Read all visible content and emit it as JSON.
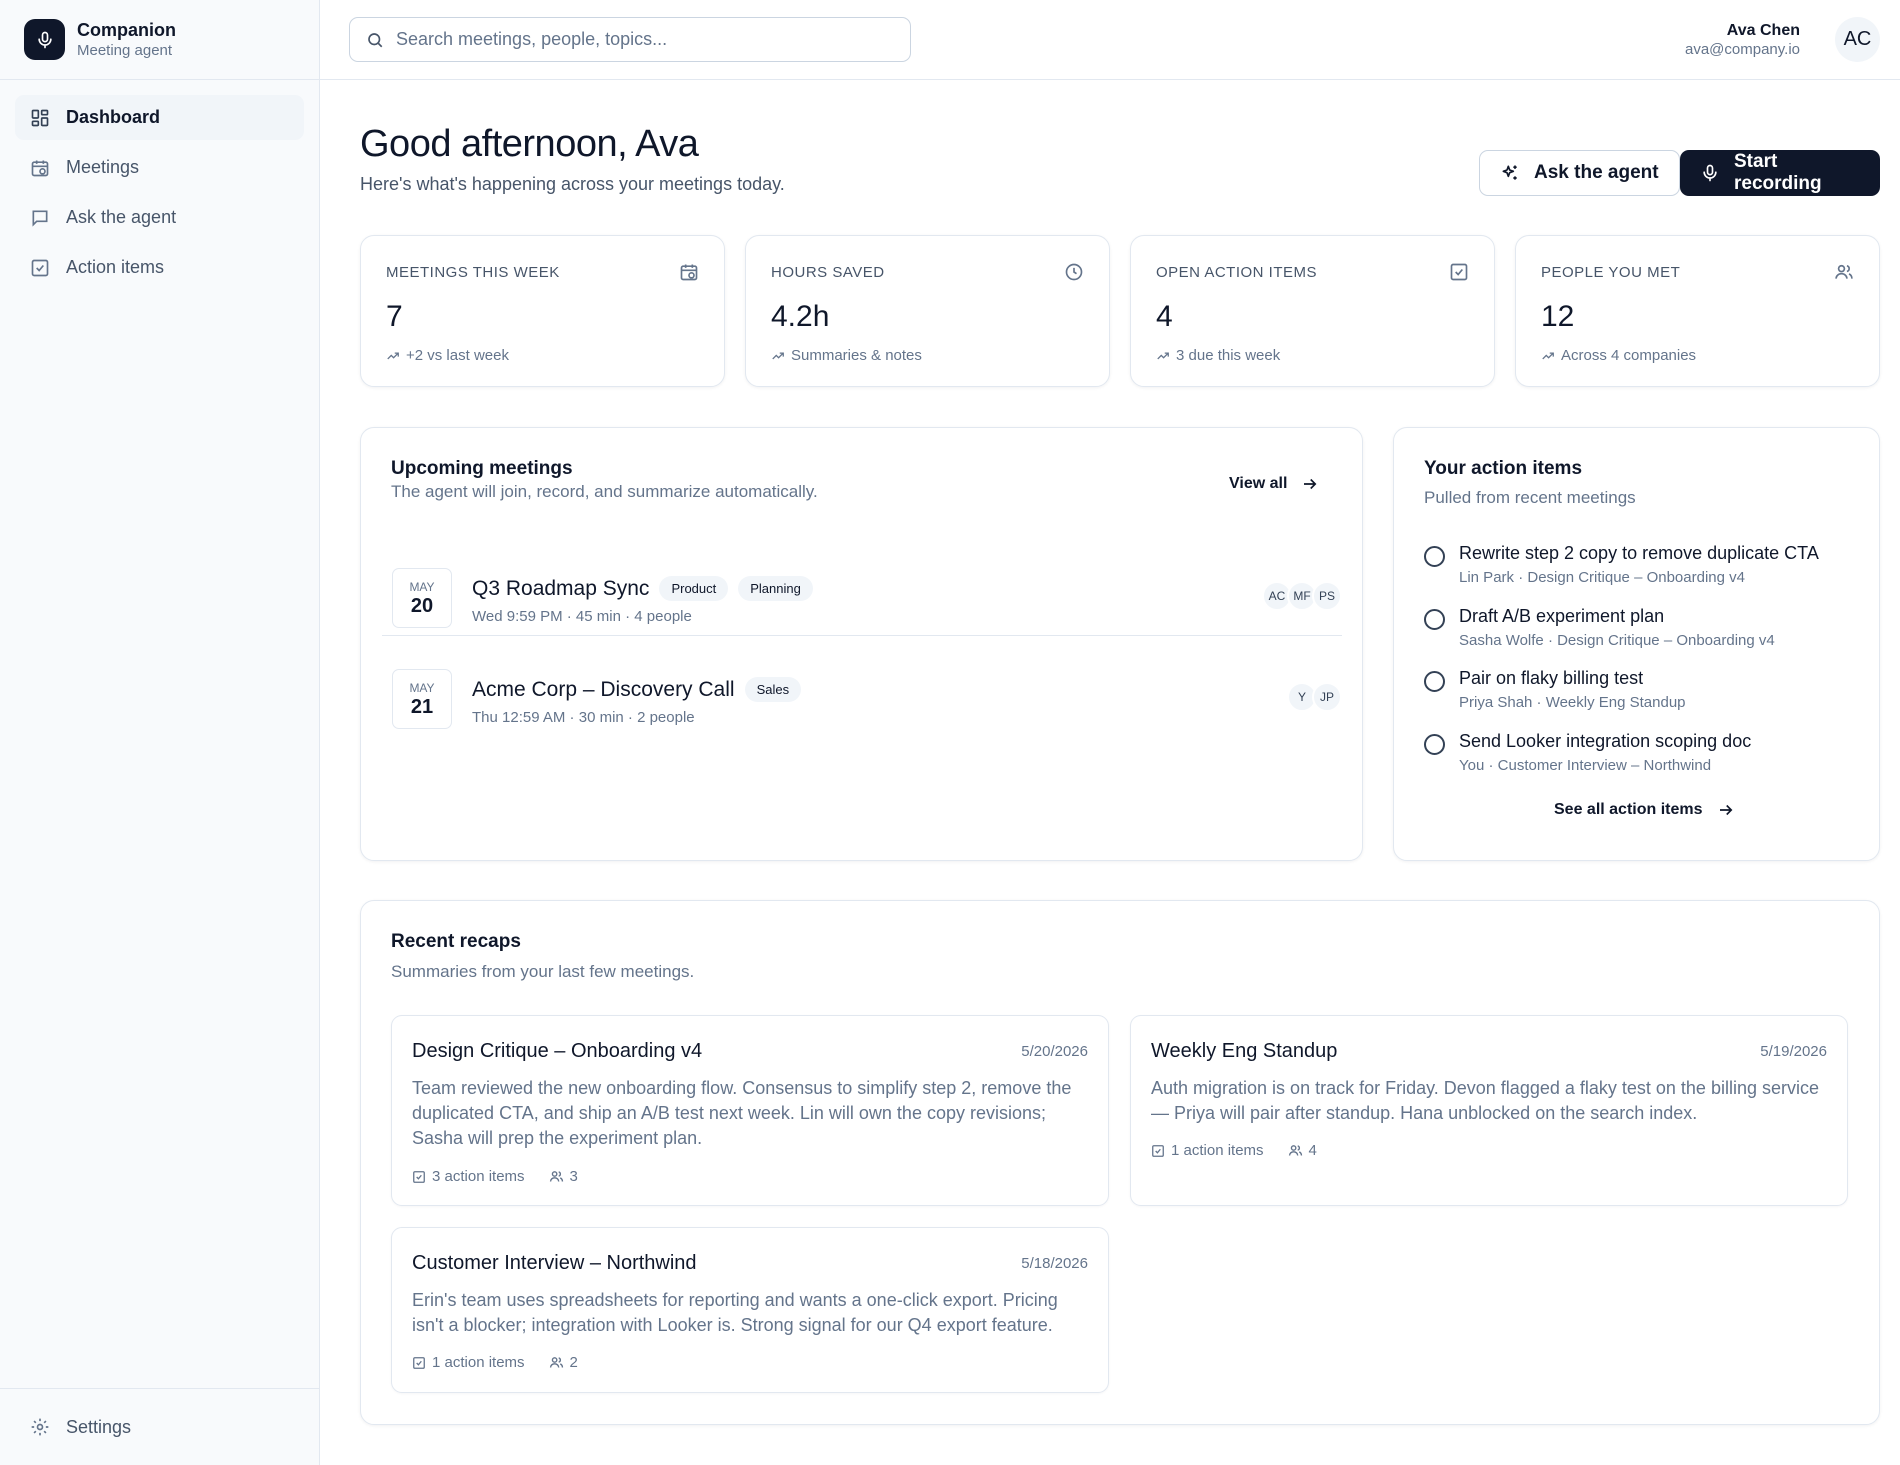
{
  "app": {
    "name": "Companion",
    "subtitle": "Meeting agent"
  },
  "sidebar": {
    "items": [
      {
        "label": "Dashboard",
        "icon": "dashboard-icon",
        "active": true
      },
      {
        "label": "Meetings",
        "icon": "calendar-clock-icon",
        "active": false
      },
      {
        "label": "Ask the agent",
        "icon": "chat-icon",
        "active": false
      },
      {
        "label": "Action items",
        "icon": "checkbox-icon",
        "active": false
      }
    ],
    "footer": {
      "label": "Settings",
      "icon": "gear-icon"
    }
  },
  "search": {
    "placeholder": "Search meetings, people, topics..."
  },
  "user": {
    "name": "Ava Chen",
    "email": "ava@company.io",
    "initials": "AC"
  },
  "header": {
    "greeting": "Good afternoon, Ava",
    "subtitle": "Here's what's happening across your meetings today.",
    "ask_label": "Ask the agent",
    "record_label": "Start recording"
  },
  "stats": [
    {
      "label": "MEETINGS THIS WEEK",
      "value": "7",
      "trend": "+2 vs last week",
      "icon": "calendar-clock-icon"
    },
    {
      "label": "HOURS SAVED",
      "value": "4.2h",
      "trend": "Summaries & notes",
      "icon": "clock-icon"
    },
    {
      "label": "OPEN ACTION ITEMS",
      "value": "4",
      "trend": "3 due this week",
      "icon": "checkbox-icon"
    },
    {
      "label": "PEOPLE YOU MET",
      "value": "12",
      "trend": "Across 4 companies",
      "icon": "users-icon"
    }
  ],
  "upcoming": {
    "title": "Upcoming meetings",
    "subtitle": "The agent will join, record, and summarize automatically.",
    "view_all": "View all",
    "meetings": [
      {
        "month": "MAY",
        "day": "20",
        "title": "Q3 Roadmap Sync",
        "tags": [
          "Product",
          "Planning"
        ],
        "meta": "Wed 9:59 PM · 45 min · 4 people",
        "attendees": [
          "AC",
          "MF",
          "PS"
        ]
      },
      {
        "month": "MAY",
        "day": "21",
        "title": "Acme Corp – Discovery Call",
        "tags": [
          "Sales"
        ],
        "meta": "Thu 12:59 AM · 30 min · 2 people",
        "attendees": [
          "Y",
          "JP"
        ]
      }
    ]
  },
  "action_items": {
    "title": "Your action items",
    "subtitle": "Pulled from recent meetings",
    "items": [
      {
        "text": "Rewrite step 2 copy to remove duplicate CTA",
        "meta": "Lin Park · Design Critique – Onboarding v4"
      },
      {
        "text": "Draft A/B experiment plan",
        "meta": "Sasha Wolfe · Design Critique – Onboarding v4"
      },
      {
        "text": "Pair on flaky billing test",
        "meta": "Priya Shah · Weekly Eng Standup"
      },
      {
        "text": "Send Looker integration scoping doc",
        "meta": "You · Customer Interview – Northwind"
      }
    ],
    "see_all": "See all action items"
  },
  "recaps": {
    "title": "Recent recaps",
    "subtitle": "Summaries from your last few meetings.",
    "items": [
      {
        "title": "Design Critique – Onboarding v4",
        "date": "5/20/2026",
        "body": "Team reviewed the new onboarding flow. Consensus to simplify step 2, remove the duplicated CTA, and ship an A/B test next week. Lin will own the copy revisions; Sasha will prep the experiment plan.",
        "actions": "3 action items",
        "people": "3"
      },
      {
        "title": "Weekly Eng Standup",
        "date": "5/19/2026",
        "body": "Auth migration is on track for Friday. Devon flagged a flaky test on the billing service — Priya will pair after standup. Hana unblocked on the search index.",
        "actions": "1 action items",
        "people": "4"
      },
      {
        "title": "Customer Interview – Northwind",
        "date": "5/18/2026",
        "body": "Erin's team uses spreadsheets for reporting and wants a one-click export. Pricing isn't a blocker; integration with Looker is. Strong signal for our Q4 export feature.",
        "actions": "1 action items",
        "people": "2"
      }
    ]
  },
  "colors": {
    "primary": "#0f172a",
    "muted": "#64748b",
    "border": "#e2e8f0",
    "sidebar_bg": "#f8fafc"
  }
}
